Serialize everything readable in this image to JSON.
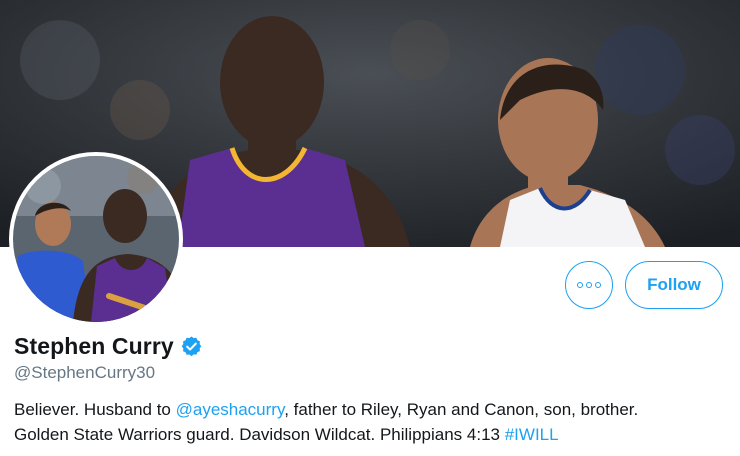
{
  "profile": {
    "name": "Stephen Curry",
    "handle": "@StephenCurry30",
    "verified": true,
    "bio": {
      "line1_part1": "Believer. Husband to ",
      "mention": "@ayeshacurry",
      "line1_part2": ", father to Riley, Ryan and Canon, son, brother.",
      "line2_part1": "Golden State Warriors guard. Davidson Wildcat. Philippians 4:13 ",
      "hashtag": "#IWILL"
    }
  },
  "actions": {
    "more_icon": "more-horizontal-icon",
    "follow_label": "Follow"
  },
  "colors": {
    "accent": "#1da1f2",
    "text": "#14171a",
    "secondary": "#657786",
    "lakers_purple": "#5b2e91",
    "lakers_gold": "#f2b632"
  }
}
